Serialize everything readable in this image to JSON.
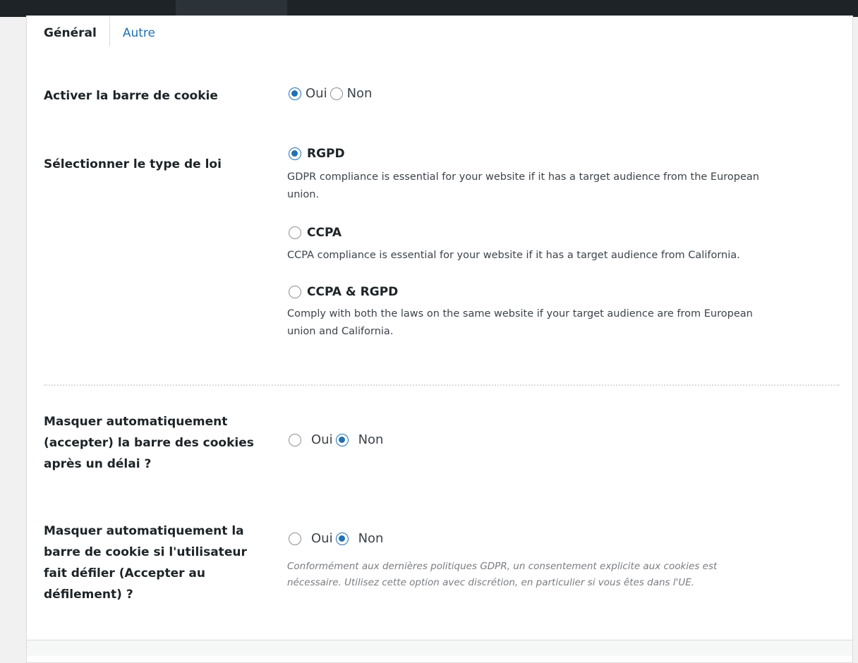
{
  "tabs": {
    "general": "Général",
    "other": "Autre"
  },
  "cookie_bar": {
    "label": "Activer la barre de cookie",
    "yes": "Oui",
    "no": "Non",
    "selected": "yes"
  },
  "law_type": {
    "label": "Sélectionner le type de loi",
    "options": [
      {
        "title": "RGPD",
        "description_line1": "GDPR compliance is essential for your website if it has a target audience from the European",
        "description_line2": "union.",
        "checked": true
      },
      {
        "title": "CCPA",
        "description_line1": "CCPA compliance is essential for your website if it has a target audience from California.",
        "checked": false
      },
      {
        "title": "CCPA & RGPD",
        "description_line1": "Comply with both the laws on the same website if your target audience are from European",
        "description_line2": "union and California.",
        "checked": false
      }
    ]
  },
  "auto_hide_delay": {
    "label_line1": "Masquer automatiquement",
    "label_line2": "(accepter) la barre des cookies",
    "label_line3": "après un délai ?",
    "yes": "Oui",
    "no": "Non",
    "selected": "no"
  },
  "auto_hide_scroll": {
    "label_line1": "Masquer automatiquement la",
    "label_line2": "barre de cookie si l'utilisateur",
    "label_line3": "fait défiler (Accepter au",
    "label_line4": "défilement) ?",
    "yes": "Oui",
    "no": "Non",
    "selected": "no",
    "note_line1": "Conformément aux dernières politiques GDPR, un consentement explicite aux cookies est",
    "note_line2": "nécessaire. Utilisez cette option avec discrétion, en particulier si vous êtes dans l'UE."
  },
  "colors": {
    "accent": "#2271b1",
    "text": "#1d2327",
    "muted": "#3c434a",
    "note": "#787c82"
  }
}
